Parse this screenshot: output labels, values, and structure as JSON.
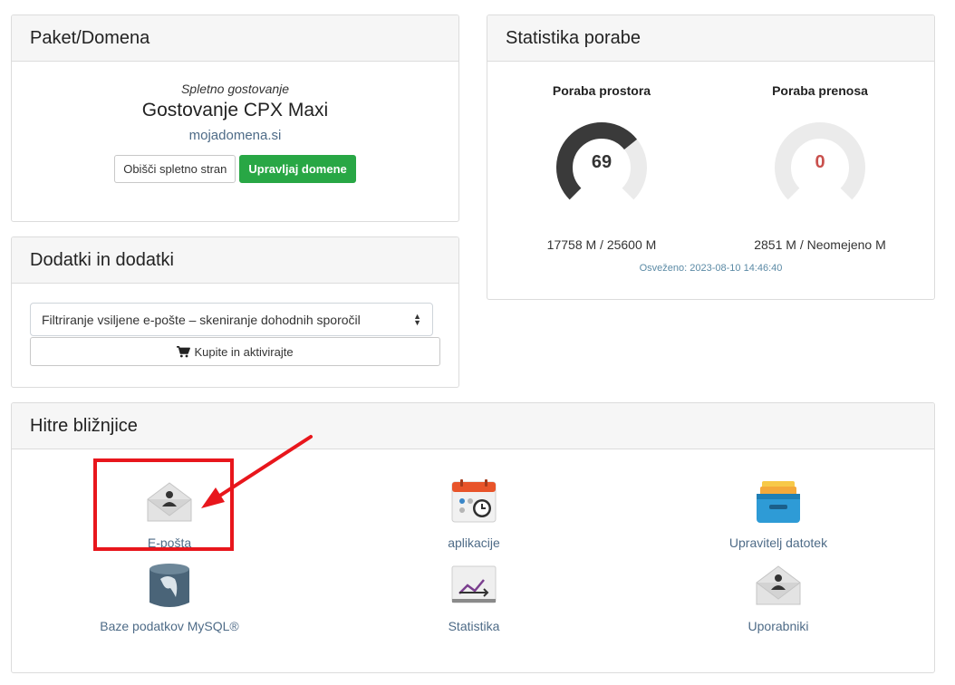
{
  "package": {
    "title": "Paket/Domena",
    "type": "Spletno gostovanje",
    "name": "Gostovanje CPX Maxi",
    "domain": "mojadomena.si",
    "visit_label": "Obišči spletno stran",
    "manage_label": "Upravljaj domene"
  },
  "addons": {
    "title": "Dodatki in dodatki",
    "selected_option": "Filtriranje vsiljene e-pošte – skeniranje dohodnih sporočil",
    "buy_label": "Kupite in aktivirajte"
  },
  "stats": {
    "title": "Statistika porabe",
    "disk": {
      "title": "Poraba prostora",
      "value": "69",
      "percent": 69,
      "usage": "17758 M / 25600 M"
    },
    "bandwidth": {
      "title": "Poraba prenosa",
      "value": "0",
      "percent": 0,
      "usage": "2851 M / Neomejeno M"
    },
    "refreshed": "Osveženo: 2023-08-10 14:46:40",
    "colors": {
      "track": "#ebebeb",
      "fill": "#3a3a3a",
      "zero_text": "#c9504d"
    }
  },
  "shortcuts": {
    "title": "Hitre bližnjice",
    "items": [
      {
        "label": "E-pošta",
        "icon": "email-envelope-icon"
      },
      {
        "label": "aplikacije",
        "icon": "calendar-clock-icon"
      },
      {
        "label": "Upravitelj datotek",
        "icon": "file-drawer-icon"
      },
      {
        "label": "Baze podatkov MySQL®",
        "icon": "database-dolphin-icon"
      },
      {
        "label": "Statistika",
        "icon": "statistics-chart-icon"
      },
      {
        "label": "Uporabniki",
        "icon": "users-envelope-icon"
      }
    ]
  },
  "annotation": {
    "color": "#e8161c"
  }
}
